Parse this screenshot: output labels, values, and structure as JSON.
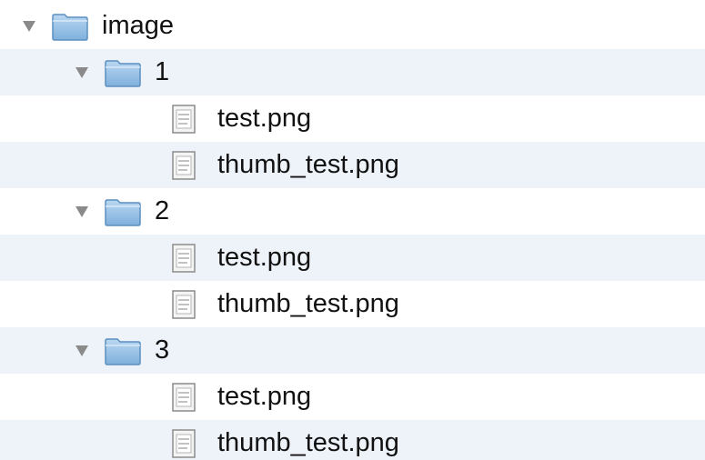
{
  "tree": {
    "root": {
      "label": "image",
      "expanded": true
    },
    "folders": [
      {
        "label": "1",
        "expanded": true,
        "files": [
          {
            "label": "test.png"
          },
          {
            "label": "thumb_test.png"
          }
        ]
      },
      {
        "label": "2",
        "expanded": true,
        "files": [
          {
            "label": "test.png"
          },
          {
            "label": "thumb_test.png"
          }
        ]
      },
      {
        "label": "3",
        "expanded": true,
        "files": [
          {
            "label": "test.png"
          },
          {
            "label": "thumb_test.png"
          }
        ]
      }
    ]
  },
  "icons": {
    "disclosure": "disclosure-triangle-down-icon",
    "folder": "folder-icon",
    "file": "file-icon"
  },
  "colors": {
    "row_alt": "#eef3fa",
    "folder_fill": "#9cc3e6",
    "folder_stroke": "#5c8fbf",
    "triangle": "#8a8a8a"
  }
}
